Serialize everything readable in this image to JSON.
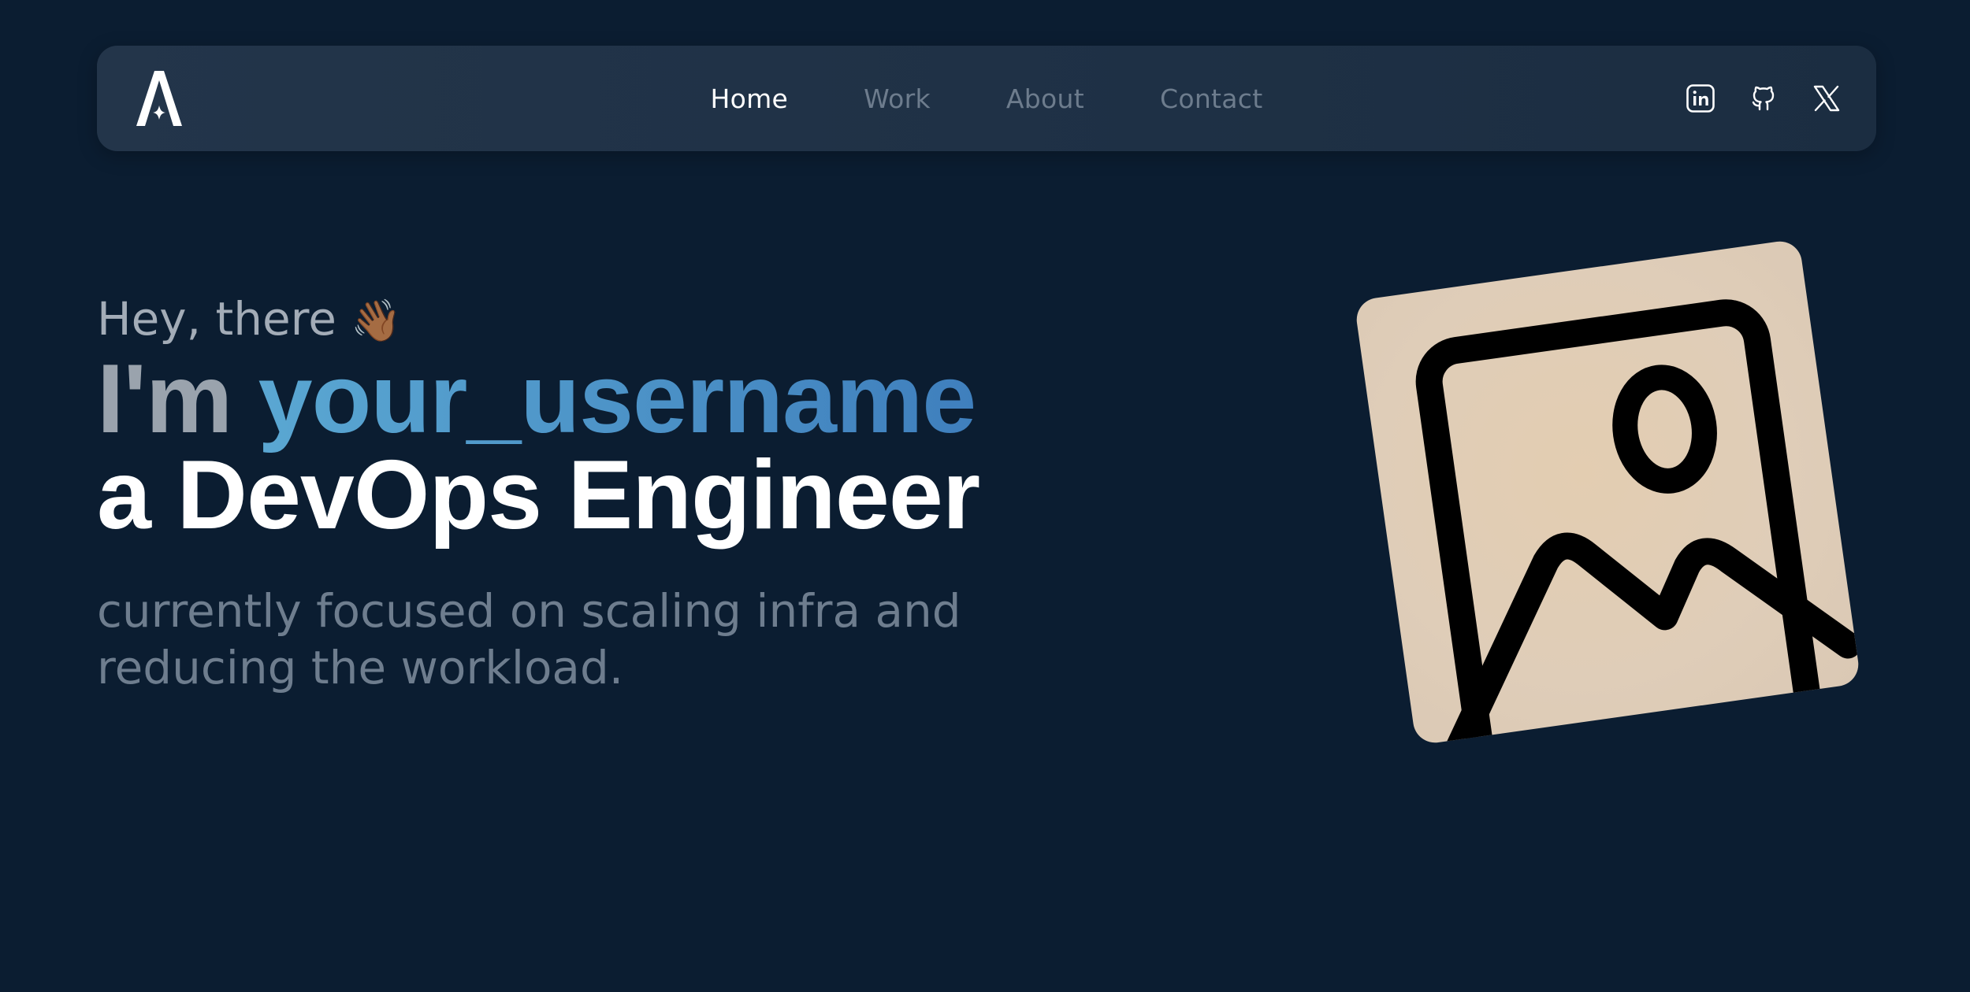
{
  "nav": {
    "links": [
      {
        "label": "Home",
        "active": true
      },
      {
        "label": "Work",
        "active": false
      },
      {
        "label": "About",
        "active": false
      },
      {
        "label": "Contact",
        "active": false
      }
    ],
    "logo_icon": "astro-logo-icon",
    "socials": [
      {
        "icon": "linkedin-icon"
      },
      {
        "icon": "github-icon"
      },
      {
        "icon": "x-twitter-icon"
      }
    ]
  },
  "hero": {
    "greeting": "Hey, there",
    "greeting_emoji": "👋🏾",
    "im_prefix": "I'm",
    "username": "your_username",
    "role": "a DevOps Engineer",
    "tagline": "currently focused on scaling infra and reducing the workload."
  },
  "image": {
    "icon": "image-placeholder-icon"
  },
  "colors": {
    "background": "#0b1d31",
    "navbar": "#1f3146",
    "accent_start": "#5aa7d2",
    "accent_end": "#3f7fbd",
    "card": "#e0ccb6"
  }
}
